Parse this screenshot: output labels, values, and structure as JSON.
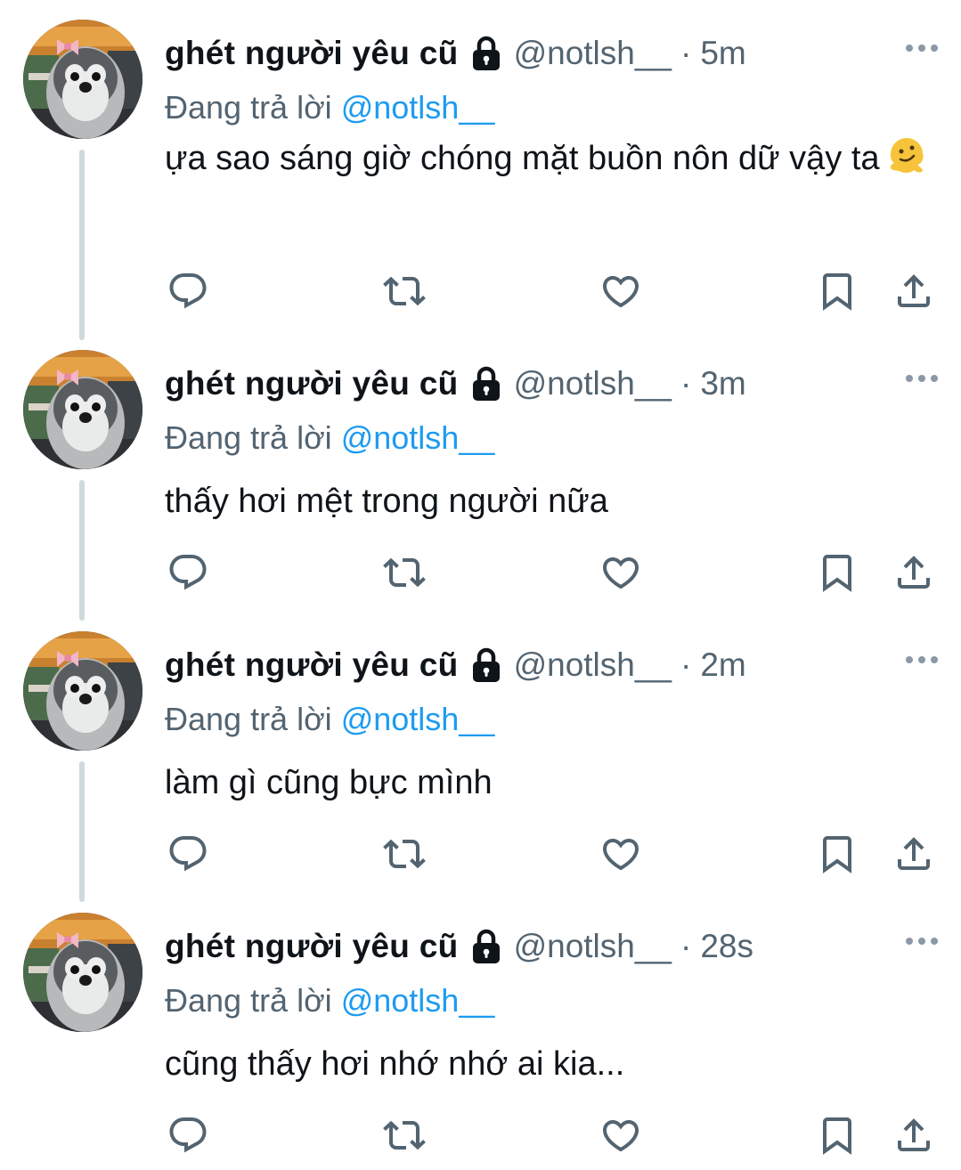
{
  "colors": {
    "text": "#0f1419",
    "secondary": "#536471",
    "mention": "#1d9bf0",
    "thread_line": "#cfd9de"
  },
  "tweets": [
    {
      "name": "ghét người yêu cũ",
      "handle": "@notlsh__",
      "dot": "·",
      "time": "5m",
      "reply_prefix": "Đang trả lời",
      "reply_to": "@notlsh__",
      "text": "ựa sao sáng giờ chóng mặt buồn nôn dữ vậy ta",
      "emoji": "melting-face-emoji"
    },
    {
      "name": "ghét người yêu cũ",
      "handle": "@notlsh__",
      "dot": "·",
      "time": "3m",
      "reply_prefix": "Đang trả lời",
      "reply_to": "@notlsh__",
      "text": "thấy hơi mệt trong người nữa"
    },
    {
      "name": "ghét người yêu cũ",
      "handle": "@notlsh__",
      "dot": "·",
      "time": "2m",
      "reply_prefix": "Đang trả lời",
      "reply_to": "@notlsh__",
      "text": "làm gì cũng bực mình"
    },
    {
      "name": "ghét người yêu cũ",
      "handle": "@notlsh__",
      "dot": "·",
      "time": "28s",
      "reply_prefix": "Đang trả lời",
      "reply_to": "@notlsh__",
      "text": "cũng thấy hơi nhớ nhớ ai kia..."
    }
  ],
  "icons": [
    "reply-icon",
    "retweet-icon",
    "like-icon",
    "bookmark-icon",
    "share-icon",
    "lock-icon",
    "more-icon"
  ]
}
